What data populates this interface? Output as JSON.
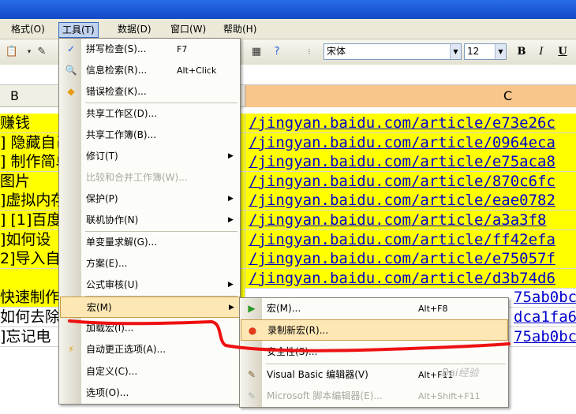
{
  "menubar": {
    "format": "格式(O)",
    "tools": "工具(T)",
    "data": "数据(D)",
    "window": "窗口(W)",
    "help": "帮助(H)"
  },
  "toolbar": {
    "font": "宋体",
    "size": "12",
    "bold": "B",
    "italic": "I",
    "underline": "U"
  },
  "columns": {
    "b": "B",
    "c": "C"
  },
  "rows": [
    {
      "b": "赚钱",
      "c": "/jingyan.baidu.com/article/e73e26c"
    },
    {
      "b": "] 隐藏自己",
      "c": "/jingyan.baidu.com/article/0964eca"
    },
    {
      "b": "] 制作简单",
      "c": "/jingyan.baidu.com/article/e75aca8"
    },
    {
      "b": "图片",
      "c": "/jingyan.baidu.com/article/870c6fc"
    },
    {
      "b": "]虚拟内存",
      "c": "/jingyan.baidu.com/article/eae0782"
    },
    {
      "b": "] [1]百度",
      "c": "/jingyan.baidu.com/article/a3a3f8"
    },
    {
      "b": "]如何设",
      "c": "/jingyan.baidu.com/article/ff42efa"
    },
    {
      "b": "2]导入自",
      "c": "/jingyan.baidu.com/article/e75057f"
    },
    {
      "b": "",
      "c": "/jingyan.baidu.com/article/d3b74d6"
    },
    {
      "b": "快速制作",
      "c": "75ab0bc"
    },
    {
      "b": "如何去除",
      "c": "dca1fa6"
    },
    {
      "b": "]忘记电",
      "c": "75ab0bc"
    }
  ],
  "tools_menu": [
    {
      "label": "拼写检查(S)...",
      "shortcut": "F7",
      "icon": "spell-check-icon"
    },
    {
      "label": "信息检索(R)...",
      "shortcut": "Alt+Click",
      "icon": "research-icon"
    },
    {
      "label": "错误检查(K)...",
      "shortcut": "",
      "icon": "error-check-icon"
    },
    {
      "label": "共享工作区(D)..."
    },
    {
      "label": "共享工作簿(B)..."
    },
    {
      "label": "修订(T)"
    },
    {
      "label": "比较和合并工作簿(W)..."
    },
    {
      "label": "保护(P)"
    },
    {
      "label": "联机协作(N)"
    },
    {
      "label": "单变量求解(G)..."
    },
    {
      "label": "方案(E)..."
    },
    {
      "label": "公式审核(U)"
    },
    {
      "label": "宏(M)"
    },
    {
      "label": "加载宏(I)..."
    },
    {
      "label": "自动更正选项(A)...",
      "icon": "autocorrect-icon"
    },
    {
      "label": "自定义(C)..."
    },
    {
      "label": "选项(O)..."
    }
  ],
  "macro_menu": [
    {
      "label": "宏(M)...",
      "shortcut": "Alt+F8",
      "icon": "play-icon"
    },
    {
      "label": "录制新宏(R)...",
      "icon": "record-icon"
    },
    {
      "label": "安全性(S)..."
    },
    {
      "label": "Visual Basic 编辑器(V)",
      "shortcut": "Alt+F11",
      "icon": "vb-editor-icon"
    },
    {
      "label": "Microsoft 脚本编辑器(E)...",
      "shortcut": "Alt+Shift+F11",
      "icon": "script-editor-icon"
    }
  ],
  "watermark": "Bai经验",
  "colors": {
    "highlight_row": "#ffff00",
    "link": "#0000cc",
    "annotation": "#ee1111",
    "menu_hover": "#fde7b4"
  }
}
